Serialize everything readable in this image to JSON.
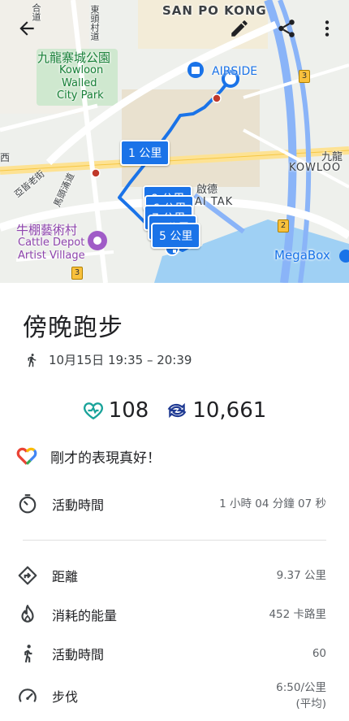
{
  "map": {
    "labels": {
      "san_po_kong": "SAN PO KONG",
      "park_zh": "九龍寨城公園",
      "park_en1": "Kowloon",
      "park_en2": "Walled",
      "park_en3": "City Park",
      "airside": "AIRSIDE",
      "kowloon_zh": "九龍",
      "kowloon_en": "KOWLOO",
      "kai_tak_zh": "啟德",
      "kai_tak_en": "AI TAK",
      "cattle_zh": "牛棚藝術村",
      "cattle_en1": "Cattle Depot",
      "cattle_en2": "Artist Village",
      "megabox": "MegaBox",
      "road1": "東頭村道",
      "road2": "亞皆老街",
      "road3": "馬頭涌道",
      "road4": "合道",
      "road_west": "西",
      "shield3a": "3",
      "shield3b": "3",
      "shield2": "2"
    },
    "km_tags": [
      "1 公里",
      "8 公里",
      "6 公里",
      "7 公里",
      "4 公里",
      "5 公里"
    ],
    "route_color": "#1a73e8"
  },
  "activity": {
    "title": "傍晚跑步",
    "datetime": "10月15日 19:35 – 20:39",
    "heart_points": "108",
    "steps": "10,661",
    "praise": "剛才的表現真好！",
    "active_time_label": "活動時間",
    "active_time_value": "1 小時 04 分鐘 07 秒"
  },
  "details": [
    {
      "label": "距離",
      "value": "9.37 公里"
    },
    {
      "label": "消耗的能量",
      "value": "452 卡路里"
    },
    {
      "label": "活動時間",
      "value": "60"
    },
    {
      "label": "步伐",
      "value": "6:50/公里",
      "value2": "(平均)"
    }
  ],
  "colors": {
    "accent": "#1a73e8",
    "heart": "#1aa39a",
    "steps": "#1f3a93"
  }
}
